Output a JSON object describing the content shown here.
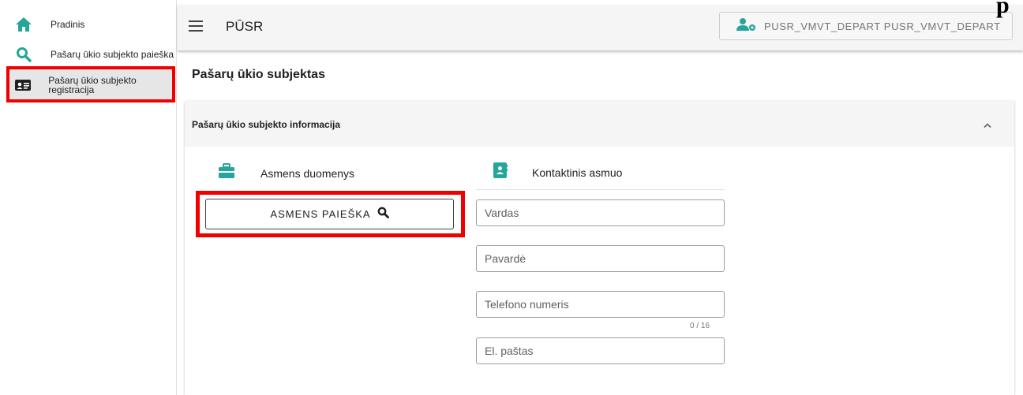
{
  "sidebar": {
    "items": [
      {
        "label": "Pradinis",
        "icon": "home-icon"
      },
      {
        "label": "Pašarų ūkio subjekto paieška",
        "icon": "search-icon"
      },
      {
        "label": "Pašarų ūkio subjekto registracija",
        "icon": "id-card-icon",
        "active": true
      }
    ]
  },
  "header": {
    "title": "PŪSR",
    "user_label": "PUSR_VMVT_DEPART PUSR_VMVT_DEPART",
    "user_icon": "user-settings-icon",
    "menu_icon": "hamburger-icon"
  },
  "corner_mark": "p",
  "page": {
    "title": "Pašarų ūkio subjektas",
    "panel": {
      "title": "Pašarų ūkio subjekto informacija",
      "collapse_icon": "chevron-up-icon",
      "personal": {
        "label": "Asmens duomenys",
        "icon": "briefcase-icon",
        "search_button": "ASMENS PAIEŠKA"
      },
      "contact": {
        "label": "Kontaktinis asmuo",
        "icon": "contact-book-icon",
        "fields": {
          "first_name": "Vardas",
          "last_name": "Pavardė",
          "phone": "Telefono numeris",
          "phone_counter": "0 / 16",
          "email": "El. paštas"
        }
      }
    }
  },
  "colors": {
    "accent": "#26a69a",
    "highlight": "#f20000",
    "header_bg": "#f5f5f5",
    "active_bg": "#e6e6e6"
  }
}
